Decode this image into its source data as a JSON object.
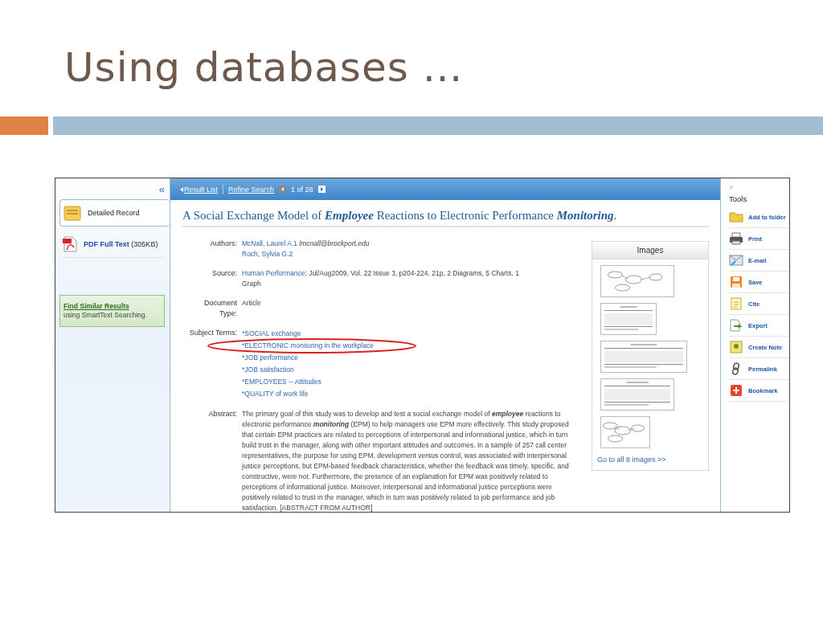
{
  "slide": {
    "title": "Using databases …"
  },
  "sidebar": {
    "collapse": "«",
    "items": [
      {
        "kind": "record",
        "label": "Detailed Record",
        "selected": true
      },
      {
        "kind": "pdf",
        "label": "PDF Full Text",
        "size": "(305KB)",
        "selected": false
      }
    ],
    "similar": {
      "link": "Find Similar Results",
      "note": "using SmartText Searching."
    }
  },
  "nav": {
    "result_list": "Result List",
    "refine": "Refine Search",
    "position": "1 of 28"
  },
  "record": {
    "title": "A Social Exchange Model of **Employee** Reactions to Electronic Performance **Monitoring**.",
    "fields": [
      {
        "kind": "authors",
        "label": "Authors:",
        "authors": [
          {
            "name": "McNall, Laurel A.1",
            "email": "lmcnall@brockport.edu"
          },
          {
            "name": "Roch, Sylvia G.2"
          }
        ]
      },
      {
        "kind": "source",
        "label": "Source:",
        "link": "Human Performance",
        "text": "; Jul/Aug2009, Vol. 22 Issue 3, p204-224, 21p, 2 Diagrams, 5 Charts, 1 Graph"
      },
      {
        "kind": "text",
        "label": "Document Type:",
        "text": "Article"
      },
      {
        "kind": "terms",
        "label": "Subject Terms:",
        "terms": [
          {
            "text": "*SOCIAL exchange",
            "circled": false
          },
          {
            "text": "*ELECTRONIC monitoring in the workplace",
            "circled": true
          },
          {
            "text": "*JOB performance",
            "circled": false
          },
          {
            "text": "*JOB satisfaction",
            "circled": false
          },
          {
            "text": "*EMPLOYEES -- Attitudes",
            "circled": false
          },
          {
            "text": "*QUALITY of work life",
            "circled": false
          }
        ]
      },
      {
        "kind": "abstract",
        "label": "Abstract:",
        "text": "The primary goal of this study was to develop and test a social exchange model of **employee** reactions to electronic performance **monitoring** (EPM) to help managers use EPM more effectively. This study proposed that certain EPM practices are related to perceptions of interpersonal and informational justice, which in turn build trust in the manager, along with other important attitudes and outcomes. In a sample of 257 call center representatives, the purpose for using EPM, development versus control, was associated with interpersonal justice perceptions, but EPM-based feedback characteristics, whether the feedback was timely, specific, and constructive, were not. Furthermore, the presence of an explanation for EPM was positively related to perceptions of informational justice. Moreover, interpersonal and informational justice perceptions were positively related to trust in the manager, which in turn was positively related to job performance and job satisfaction. [ABSTRACT FROM AUTHOR]"
      }
    ]
  },
  "images": {
    "heading": "Images",
    "more": "Go to all 8 images >>"
  },
  "tools": {
    "expand": "»",
    "heading": "Tools",
    "items": [
      {
        "kind": "folder",
        "label": "Add to folder"
      },
      {
        "kind": "print",
        "label": "Print"
      },
      {
        "kind": "email",
        "label": "E-mail"
      },
      {
        "kind": "save",
        "label": "Save"
      },
      {
        "kind": "cite",
        "label": "Cite"
      },
      {
        "kind": "export",
        "label": "Export"
      },
      {
        "kind": "note",
        "label": "Create Note"
      },
      {
        "kind": "permalink",
        "label": "Permalink"
      },
      {
        "kind": "bookmark",
        "label": "Bookmark"
      }
    ]
  }
}
